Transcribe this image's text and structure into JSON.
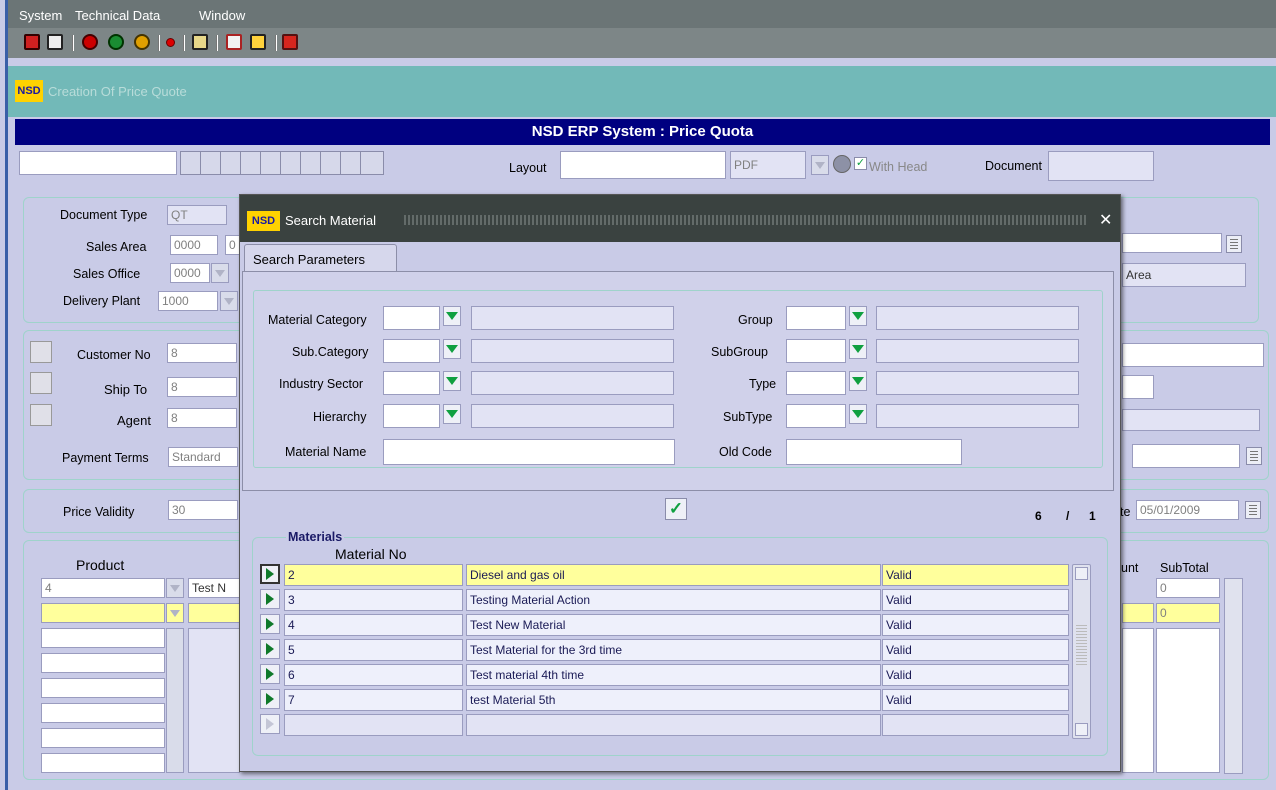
{
  "menu": [
    "System",
    "Technical Data",
    "Window"
  ],
  "app_header": {
    "logo": "NSD",
    "title": "Creation Of Price Quote"
  },
  "title_bar": "NSD ERP System : Price Quota",
  "print_bar": {
    "layout_label": "Layout",
    "format_value": "PDF",
    "with_head_label": "With Head",
    "with_head_checked": true,
    "document_label": "Document"
  },
  "header_form": {
    "document_type_label": "Document Type",
    "document_type_value": "QT",
    "sales_area_label": "Sales Area",
    "sales_area_value": "0000",
    "sales_area_value2": "0",
    "sales_office_label": "Sales Office",
    "sales_office_value": "0000",
    "delivery_plant_label": "Delivery Plant",
    "delivery_plant_value": "1000",
    "area_text": "Area"
  },
  "customer_form": {
    "customer_no_label": "Customer No",
    "customer_no_value": "8",
    "ship_to_label": "Ship To",
    "ship_to_value": "8",
    "agent_label": "Agent",
    "agent_value": "8",
    "payment_terms_label": "Payment Terms",
    "payment_terms_value": "Standard"
  },
  "validity": {
    "price_validity_label": "Price Validity",
    "price_validity_value": "30",
    "date_label": "te",
    "date_value": "05/01/2009"
  },
  "product_grid": {
    "product_label": "Product",
    "product_value": "4",
    "test_text": "Test N",
    "amount_label": "unt",
    "subtotal_label": "SubTotal",
    "subtotals": [
      "0",
      "0"
    ]
  },
  "dialog": {
    "logo": "NSD",
    "title": "Search Material",
    "close_glyph": "✕",
    "tab_label": "Search Parameters",
    "params_left": [
      {
        "label": "Material Category"
      },
      {
        "label": "Sub.Category"
      },
      {
        "label": "Industry Sector"
      },
      {
        "label": "Hierarchy"
      }
    ],
    "params_right": [
      {
        "label": "Group"
      },
      {
        "label": "SubGroup"
      },
      {
        "label": "Type"
      },
      {
        "label": "SubType"
      }
    ],
    "material_name_label": "Material Name",
    "old_code_label": "Old Code",
    "record_current": "6",
    "record_sep": "/",
    "record_total": "1",
    "materials_group_label": "Materials",
    "material_no_header": "Material No",
    "rows": [
      {
        "no": "2",
        "name": "Diesel and gas oil",
        "status": "Valid"
      },
      {
        "no": "3",
        "name": "Testing Material Action",
        "status": "Valid"
      },
      {
        "no": "4",
        "name": "Test New Material",
        "status": "Valid"
      },
      {
        "no": "5",
        "name": "Test Material for the 3rd time",
        "status": "Valid"
      },
      {
        "no": "6",
        "name": "Test material 4th time",
        "status": "Valid"
      },
      {
        "no": "7",
        "name": "test Material 5th",
        "status": "Valid"
      },
      {
        "no": "",
        "name": "",
        "status": ""
      }
    ]
  },
  "colors": {
    "title_bar": "#000080",
    "header_strip": "#72b9b8",
    "dialog_title": "#3a4240",
    "selected_row": "#ffff9c",
    "lov_green": "#10a040"
  }
}
